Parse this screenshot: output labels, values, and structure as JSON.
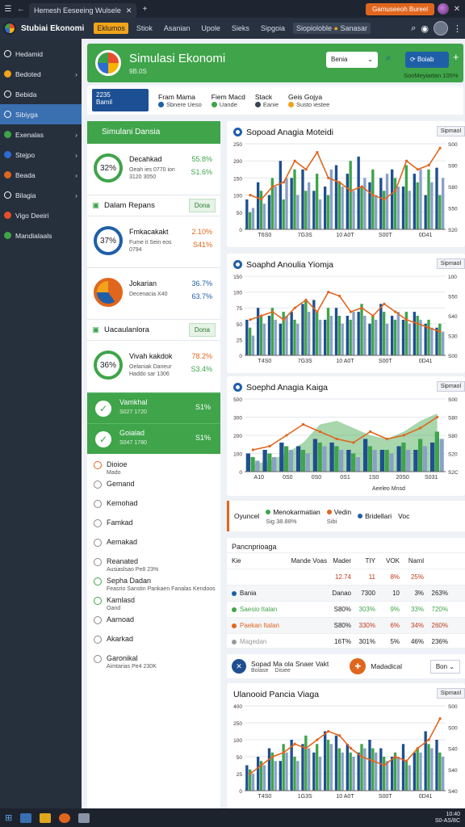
{
  "browser": {
    "tab_title": "Hemesh Eeseeing Wulsele",
    "action_label": "Gamuseeoh Bureel"
  },
  "app": {
    "title": "Stubiai Ekonomi",
    "nav": [
      "Eklumos",
      "Stiok",
      "Asanian",
      "Upole",
      "Sieks",
      "Sipgoia",
      "Siopioloble",
      "Sanasar"
    ]
  },
  "sidebar": {
    "items": [
      {
        "label": "Hedamid",
        "color": "#ffffff",
        "chevron": false
      },
      {
        "label": "Bedoted",
        "color": "#f0a31b",
        "chevron": true
      },
      {
        "label": "Bebida",
        "color": "#ffffff",
        "chevron": false
      },
      {
        "label": "Sibiyga",
        "color": "#ffffff",
        "chevron": false
      },
      {
        "label": "Exenalas",
        "color": "#3fa44a",
        "chevron": true
      },
      {
        "label": "Stejpo",
        "color": "#2e6bd3",
        "chevron": true
      },
      {
        "label": "Beada",
        "color": "#e0661e",
        "chevron": true
      },
      {
        "label": "Bilagia",
        "color": "#ffffff",
        "chevron": true
      },
      {
        "label": "Vigo Deeiri",
        "color": "#e94d2b",
        "chevron": false
      },
      {
        "label": "Mandialaals",
        "color": "#3fa44a",
        "chevron": false
      }
    ],
    "active_index": 3
  },
  "hero": {
    "title": "Simulasi Ekonomi",
    "subtitle": "9B.0S",
    "select_value": "Benia",
    "button": "Boiab",
    "note": "SooMeyiartan 105%"
  },
  "stats": {
    "big_line1": "2235",
    "big_line2": "Bamil",
    "items": [
      {
        "title": "Fram Mama",
        "sub": "Sbnere Ueso",
        "color": "#1f5fa8"
      },
      {
        "title": "Fiem Macd",
        "sub": "Uande",
        "color": "#3fa44a"
      },
      {
        "title": "Stack",
        "sub": "Eanie",
        "color": "#3a4556"
      },
      {
        "title": "Geis Gojya",
        "sub": "Susto iestee",
        "color": "#f0a31b"
      }
    ]
  },
  "left": {
    "header": "Simulani Dansia",
    "cards": [
      {
        "ring": "32%",
        "ring_color": "#3fa44a",
        "name": "Decahkad",
        "sub": "Oeah ies 0770 ion 3120 3050",
        "v1": "55.8%",
        "v1_color": "#3fa44a",
        "v2": "S1.6%",
        "v2_color": "#3fa44a"
      },
      {
        "ring": "37%",
        "ring_color": "#1f5fa8",
        "name": "Fmkacakakt",
        "sub": "Fume it Sein eos 0794",
        "v1": "2.10%",
        "v1_color": "#e0661e",
        "v2": "S41%",
        "v2_color": "#e0661e"
      },
      {
        "ring": "",
        "ring_color": "#e0661e",
        "name": "Jokarian",
        "sub": "Decenacia X40",
        "v1": "36.7%",
        "v1_color": "#1f5fa8",
        "v2": "63.7%",
        "v2_color": "#1f5fa8"
      }
    ],
    "section1": {
      "title": "Dalam Repans",
      "button": "Dona"
    },
    "section2": {
      "title": "Uacaulanlora",
      "button": "Dona"
    },
    "card4": {
      "ring": "36%",
      "ring_color": "#3fa44a",
      "name": "Vivah kakdok",
      "sub": "Oelaniak Daneur Haddo sar 1306",
      "v1": "78.2%",
      "v1_color": "#e0661e",
      "v2": "S3.4%",
      "v2_color": "#3fa44a"
    },
    "green_rows": [
      {
        "name": "Vamkhal",
        "sub": "S027 1720",
        "pct": "S1%"
      },
      {
        "name": "Goialad",
        "sub": "S047 1780",
        "pct": "S1%"
      }
    ],
    "list": [
      {
        "label": "Dioioe",
        "detail": "Mado",
        "ring": "o"
      },
      {
        "label": "Gemand",
        "detail": "",
        "ring": ""
      },
      {
        "label": "Kemohad",
        "detail": "",
        "ring": ""
      },
      {
        "label": "Famkad",
        "detail": "",
        "ring": ""
      },
      {
        "label": "Aemakad",
        "detail": "",
        "ring": ""
      },
      {
        "label": "Reanated",
        "detail": "Ausiaslsao Pe8 23%",
        "ring": ""
      },
      {
        "label": "Sepha Dadan",
        "detail": "Feasrio Sanstin Pankaen Fanalas Kendoos",
        "ring": "g"
      },
      {
        "label": "Kamlasd",
        "detail": "Oand",
        "ring": "g"
      },
      {
        "label": "Aarnoad",
        "detail": "",
        "ring": ""
      },
      {
        "label": "Akarkad",
        "detail": "",
        "ring": ""
      },
      {
        "label": "Garonikal",
        "detail": "Aimtarias Pe4 230K",
        "ring": ""
      }
    ]
  },
  "charts": [
    {
      "title": "Sopoad Anagia Moteidi",
      "button": "Sipmaol"
    },
    {
      "title": "Soaphd Anoulia Yiomja",
      "button": "Sipmaol"
    },
    {
      "title": "Soephd Anagia Kaiga",
      "button": "Sipmaol",
      "xlabel": "Aeeleo Mnsd"
    },
    {
      "title": "Ulanooid Pancia Viaga",
      "button": "Sipmaol"
    }
  ],
  "chart_data": [
    {
      "type": "bar",
      "categories": [
        "T6S0",
        "7G3S",
        "10 A0T",
        "S00T",
        "0D41"
      ],
      "series": [
        {
          "values": [
            35,
            55,
            40,
            80,
            60,
            70,
            45,
            50,
            75,
            65,
            85,
            55,
            60,
            70,
            50,
            65,
            40,
            72
          ]
        },
        {
          "values": [
            20,
            45,
            60,
            35,
            70,
            45,
            65,
            40,
            55,
            80,
            50,
            70,
            45,
            60,
            75,
            55,
            70,
            40
          ]
        },
        {
          "values": [
            25,
            30,
            50,
            60,
            40,
            55,
            35,
            70,
            50,
            45,
            60,
            40,
            65,
            50,
            45,
            70,
            55,
            60
          ]
        }
      ],
      "line": [
        40,
        35,
        50,
        55,
        80,
        70,
        90,
        60,
        55,
        45,
        50,
        40,
        35,
        45,
        80,
        70,
        75,
        95
      ],
      "ylim": [
        0,
        100
      ],
      "yticks_left": [
        "0",
        "50",
        "100",
        "150",
        "200",
        "250"
      ],
      "yticks_right": [
        "S00",
        "S90",
        "S80",
        "S50",
        "S20"
      ]
    },
    {
      "type": "bar",
      "categories": [
        "T4S0",
        "7G3S",
        "10 A0T",
        "S00T",
        "0D41"
      ],
      "series": [
        {
          "values": [
            45,
            60,
            50,
            40,
            55,
            65,
            70,
            45,
            60,
            50,
            55,
            40,
            65,
            50,
            45,
            55,
            40,
            35
          ]
        },
        {
          "values": [
            35,
            50,
            60,
            55,
            45,
            70,
            55,
            60,
            50,
            45,
            65,
            50,
            55,
            45,
            55,
            50,
            45,
            40
          ]
        },
        {
          "values": [
            25,
            40,
            45,
            50,
            40,
            55,
            45,
            50,
            40,
            55,
            50,
            45,
            40,
            55,
            40,
            45,
            35,
            30
          ]
        }
      ],
      "line": [
        45,
        50,
        55,
        45,
        60,
        70,
        55,
        80,
        75,
        55,
        60,
        50,
        65,
        55,
        45,
        40,
        35,
        30
      ],
      "ylim": [
        0,
        100
      ],
      "yticks_left": [
        "0",
        "25",
        "50",
        "75",
        "100",
        "150"
      ],
      "yticks_right": [
        "100",
        "S50",
        "S40",
        "S30",
        "S00"
      ]
    },
    {
      "type": "bar",
      "categories": [
        "A10",
        "0S0",
        "0S0",
        "0S1",
        "1S0",
        "20S0",
        "S031"
      ],
      "series": [
        {
          "values": [
            25,
            30,
            40,
            35,
            45,
            40,
            30,
            45,
            30,
            35,
            30,
            40
          ]
        },
        {
          "values": [
            20,
            25,
            35,
            30,
            40,
            35,
            25,
            35,
            30,
            40,
            45,
            55
          ]
        },
        {
          "values": [
            15,
            20,
            30,
            25,
            35,
            30,
            20,
            30,
            25,
            30,
            35,
            45
          ]
        }
      ],
      "line": [
        30,
        35,
        50,
        65,
        55,
        45,
        40,
        55,
        45,
        50,
        60,
        75
      ],
      "area": [
        10,
        15,
        25,
        40,
        65,
        70,
        60,
        50,
        45,
        55,
        70,
        80
      ],
      "ylim": [
        0,
        100
      ],
      "yticks_left": [
        "0",
        "100",
        "200",
        "300",
        "500"
      ],
      "yticks_right": [
        "S00",
        "S80",
        "S80",
        "S20",
        "S2C"
      ]
    },
    {
      "type": "bar",
      "categories": [
        "T4S0",
        "1G3S",
        "10 A0T",
        "S00T",
        "0D41"
      ],
      "series": [
        {
          "values": [
            30,
            40,
            50,
            35,
            60,
            55,
            45,
            70,
            65,
            55,
            45,
            60,
            50,
            40,
            55,
            45,
            70,
            60
          ]
        },
        {
          "values": [
            25,
            35,
            45,
            55,
            40,
            65,
            55,
            60,
            50,
            45,
            55,
            50,
            40,
            45,
            35,
            50,
            55,
            45
          ]
        },
        {
          "values": [
            20,
            30,
            35,
            45,
            35,
            50,
            40,
            55,
            45,
            40,
            50,
            45,
            35,
            40,
            30,
            45,
            50,
            40
          ]
        }
      ],
      "line": [
        20,
        30,
        40,
        45,
        55,
        50,
        60,
        70,
        65,
        50,
        40,
        35,
        30,
        40,
        35,
        50,
        60,
        85
      ],
      "ylim": [
        0,
        100
      ],
      "yticks_left": [
        "0",
        "25",
        "50",
        "100",
        "250",
        "400"
      ],
      "yticks_right": [
        "S00",
        "S00",
        "S40",
        "S40",
        "S40"
      ]
    }
  ],
  "legend": [
    {
      "label": "Oyuncel",
      "value": "",
      "color": "#111111"
    },
    {
      "label": "Menokarmatian",
      "value": "Sig 38.88%",
      "color": "#3fa44a"
    },
    {
      "label": "Vedin",
      "value": "Sibi",
      "color": "#e0661e"
    },
    {
      "label": "Bridellari",
      "value": "",
      "color": "#1f5fa8"
    },
    {
      "label": "Voc",
      "value": "",
      "color": "#111111"
    }
  ],
  "table": {
    "title": "Pancnprioaga",
    "header": [
      "Kie",
      "Mader",
      "TIY",
      "VOK",
      "Narnl"
    ],
    "header_vals": [
      "Mande Voas",
      "12.74",
      "11",
      "8%",
      "25%"
    ],
    "rows": [
      {
        "name": "Bania",
        "color": "#1f5fa8",
        "cells": [
          "Danao",
          "7300",
          "10",
          "3%",
          "263%"
        ]
      },
      {
        "name": "Saesio Italan",
        "color": "#3fa44a",
        "cells": [
          "S80%",
          "303%",
          "9%",
          "33%",
          "720%"
        ]
      },
      {
        "name": "Paekan Italan",
        "color": "#e0661e",
        "cells": [
          "S80%",
          "330%",
          "6%",
          "34%",
          "260%"
        ]
      },
      {
        "name": "Magedan",
        "color": "#999999",
        "cells": [
          "16T%",
          "301%",
          "5%",
          "46%",
          "236%"
        ]
      }
    ]
  },
  "action": {
    "title": "Sopad Ma ola Snaer Vakt",
    "tags": [
      "Bolase",
      "Disiee"
    ],
    "mid": "Madadical",
    "button": "Bon"
  },
  "taskbar": {
    "time": "10:40",
    "date": "S0-AS/8C"
  }
}
